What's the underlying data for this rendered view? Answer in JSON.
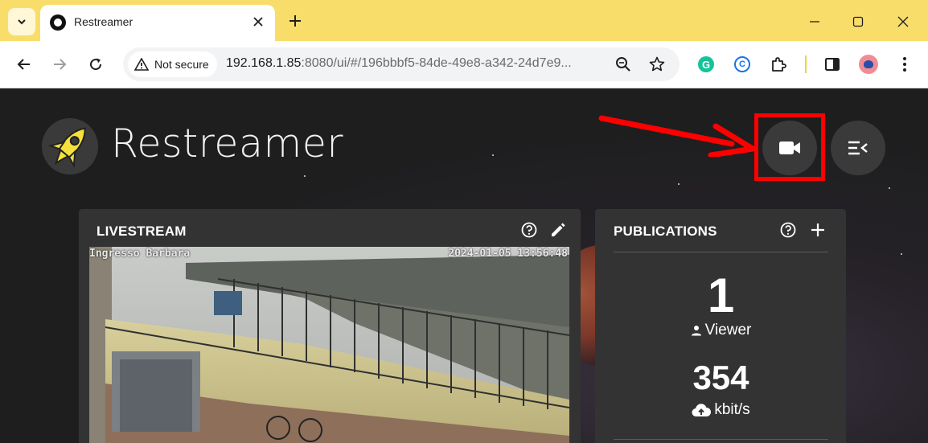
{
  "browser": {
    "tab_title": "Restreamer",
    "security_label": "Not secure",
    "url_host": "192.168.1.85",
    "url_rest": ":8080/ui/#/196bbbf5-84de-49e8-a342-24d7e9..."
  },
  "app": {
    "brand": "Restreamer",
    "livestream": {
      "title": "LIVESTREAM",
      "overlay_label": "Ingresso Barbara",
      "overlay_time": "2024-01-05 13:56:48"
    },
    "publications": {
      "title": "PUBLICATIONS",
      "viewers": "1",
      "viewer_label": "Viewer",
      "bitrate": "354",
      "bitrate_unit": "kbit/s"
    }
  },
  "colors": {
    "tabstrip": "#f9dd6b",
    "highlight": "#ff0000",
    "logo_yellow": "#f5e13a"
  }
}
